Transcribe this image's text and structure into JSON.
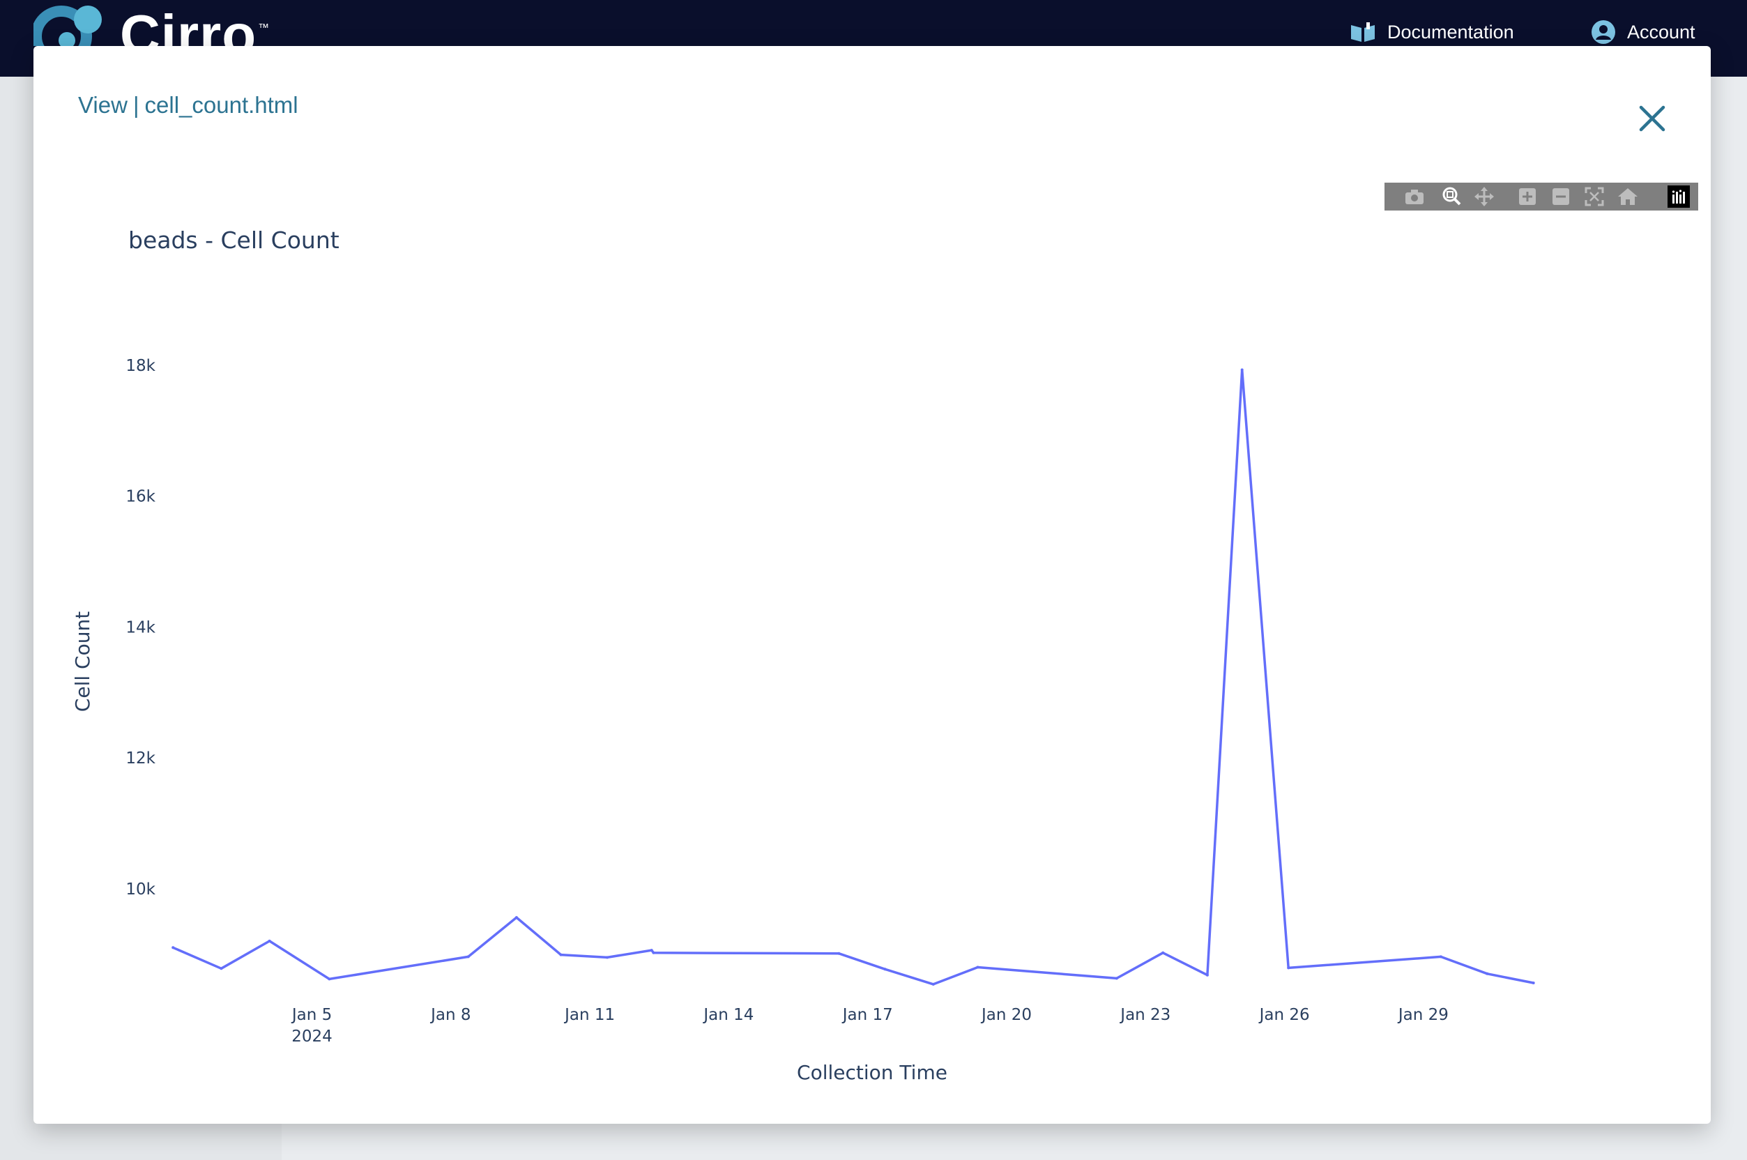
{
  "app": {
    "brand": "Cirro",
    "brand_mark": "™",
    "nav": {
      "documentation": "Documentation",
      "account": "Account"
    }
  },
  "modal": {
    "title_prefix": "View",
    "title_separator": "|",
    "title_file": "cell_count.html",
    "close_icon": "close-icon"
  },
  "modebar": {
    "buttons": [
      "camera-icon",
      "zoom-icon",
      "pan-icon",
      "zoom-in-icon",
      "zoom-out-icon",
      "autoscale-icon",
      "reset-axes-icon",
      "plotly-logo-icon"
    ]
  },
  "colors": {
    "navbar": "#0a0f2c",
    "accent": "#2c7391",
    "line": "#636efa",
    "text": "#2a3f5f"
  },
  "chart_data": {
    "type": "line",
    "title": "beads - Cell Count",
    "xlabel": "Collection Time",
    "ylabel": "Cell Count",
    "x_range": [
      "2024-01-01T12:00",
      "2024-01-31T12:00"
    ],
    "ylim": [
      8400,
      18500
    ],
    "y_ticks": [
      {
        "value": 10000,
        "label": "10k"
      },
      {
        "value": 12000,
        "label": "12k"
      },
      {
        "value": 14000,
        "label": "14k"
      },
      {
        "value": 16000,
        "label": "16k"
      },
      {
        "value": 18000,
        "label": "18k"
      }
    ],
    "x_ticks": [
      {
        "value": "2024-01-05",
        "label": "Jan 5",
        "sublabel": "2024"
      },
      {
        "value": "2024-01-08",
        "label": "Jan 8"
      },
      {
        "value": "2024-01-11",
        "label": "Jan 11"
      },
      {
        "value": "2024-01-14",
        "label": "Jan 14"
      },
      {
        "value": "2024-01-17",
        "label": "Jan 17"
      },
      {
        "value": "2024-01-20",
        "label": "Jan 20"
      },
      {
        "value": "2024-01-23",
        "label": "Jan 23"
      },
      {
        "value": "2024-01-26",
        "label": "Jan 26"
      },
      {
        "value": "2024-01-29",
        "label": "Jan 29"
      }
    ],
    "grid": false,
    "series": [
      {
        "x": [
          "2024-01-02T00:00",
          "2024-01-03T01:00",
          "2024-01-04T02:00",
          "2024-01-05T09:00",
          "2024-01-08T09:00",
          "2024-01-09T10:00",
          "2024-01-10T09:00",
          "2024-01-11T09:00",
          "2024-01-12T08:00",
          "2024-01-12T09:00",
          "2024-01-16T09:00",
          "2024-01-17T09:00",
          "2024-01-18T10:00",
          "2024-01-19T09:00",
          "2024-01-22T09:00",
          "2024-01-23T09:00",
          "2024-01-24T08:00",
          "2024-01-25T02:00",
          "2024-01-26T02:00",
          "2024-01-29T09:00",
          "2024-01-30T09:00",
          "2024-01-31T09:00"
        ],
        "values": [
          9100,
          8780,
          9200,
          8620,
          8960,
          9560,
          8990,
          8950,
          9060,
          9020,
          9010,
          8770,
          8540,
          8800,
          8630,
          9020,
          8680,
          17930,
          8790,
          8960,
          8700,
          8560
        ]
      }
    ]
  }
}
